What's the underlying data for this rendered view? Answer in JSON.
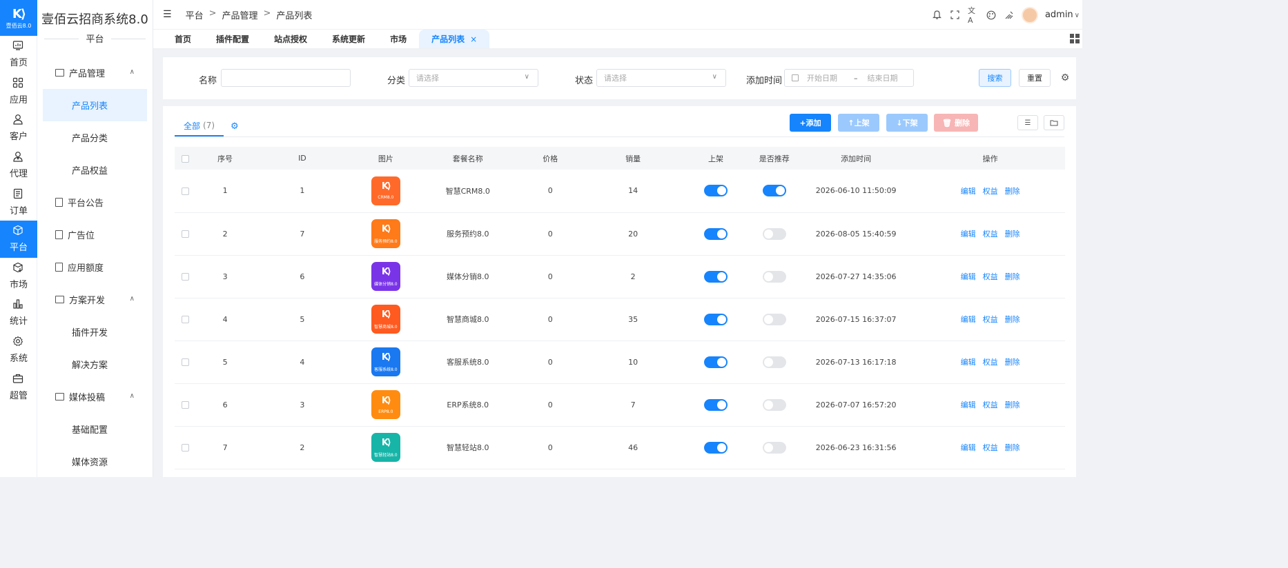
{
  "rail": {
    "logo_text": "壹佰云8.0",
    "items": [
      {
        "label": "首页",
        "icon": "chart-icon"
      },
      {
        "label": "应用",
        "icon": "grid-icon"
      },
      {
        "label": "客户",
        "icon": "user-icon"
      },
      {
        "label": "代理",
        "icon": "agent-icon"
      },
      {
        "label": "订单",
        "icon": "order-icon"
      },
      {
        "label": "平台",
        "icon": "cube-icon",
        "active": true
      },
      {
        "label": "市场",
        "icon": "market-icon"
      },
      {
        "label": "统计",
        "icon": "stats-icon"
      },
      {
        "label": "系统",
        "icon": "gear-icon"
      },
      {
        "label": "超管",
        "icon": "briefcase-icon"
      }
    ]
  },
  "sidebar": {
    "title": "壹佰云招商系统8.0",
    "subtitle": "平台",
    "groups": [
      {
        "label": "产品管理",
        "items": [
          "产品列表",
          "产品分类",
          "产品权益"
        ]
      },
      {
        "label": "平台公告"
      },
      {
        "label": "广告位"
      },
      {
        "label": "应用额度"
      },
      {
        "label": "方案开发",
        "items": [
          "插件开发",
          "解决方案"
        ]
      },
      {
        "label": "媒体投稿",
        "items": [
          "基础配置",
          "媒体资源"
        ]
      }
    ]
  },
  "topbar": {
    "breadcrumb": [
      "平台",
      "产品管理",
      "产品列表"
    ],
    "user": "admin"
  },
  "tabs": [
    "首页",
    "插件配置",
    "站点授权",
    "系统更新",
    "市场",
    "产品列表"
  ],
  "filter": {
    "name_label": "名称",
    "category_label": "分类",
    "category_placeholder": "请选择",
    "status_label": "状态",
    "status_placeholder": "请选择",
    "time_label": "添加时间",
    "start_placeholder": "开始日期",
    "end_placeholder": "结束日期",
    "range_sep": "–",
    "search": "搜索",
    "reset": "重置"
  },
  "table_tabs": {
    "all": "全部",
    "count": "(7)"
  },
  "actions": {
    "add": "+添加",
    "up": "↑上架",
    "down": "↓下架",
    "delete": "删除"
  },
  "columns": [
    "序号",
    "ID",
    "图片",
    "套餐名称",
    "价格",
    "销量",
    "上架",
    "是否推荐",
    "添加时间",
    "操作"
  ],
  "row_ops": [
    "编辑",
    "权益",
    "删除"
  ],
  "rows": [
    {
      "no": "1",
      "id": "1",
      "thumb": "CRM8.0",
      "thumb_color": "#ff6a2a",
      "name": "智慧CRM8.0",
      "price": "0",
      "sales": "14",
      "listed": true,
      "recommended": true,
      "time": "2026-06-10 11:50:09"
    },
    {
      "no": "2",
      "id": "7",
      "thumb": "服务预约8.0",
      "thumb_color": "#ff7a18",
      "name": "服务预约8.0",
      "price": "0",
      "sales": "20",
      "listed": true,
      "recommended": false,
      "time": "2026-08-05 15:40:59"
    },
    {
      "no": "3",
      "id": "6",
      "thumb": "媒体分销8.0",
      "thumb_color": "#7a34e8",
      "name": "媒体分销8.0",
      "price": "0",
      "sales": "2",
      "listed": true,
      "recommended": false,
      "time": "2026-07-27 14:35:06"
    },
    {
      "no": "4",
      "id": "5",
      "thumb": "智慧商城8.0",
      "thumb_color": "#ff5a1f",
      "name": "智慧商城8.0",
      "price": "0",
      "sales": "35",
      "listed": true,
      "recommended": false,
      "time": "2026-07-15 16:37:07"
    },
    {
      "no": "5",
      "id": "4",
      "thumb": "客服系统8.0",
      "thumb_color": "#1a78f0",
      "name": "客服系统8.0",
      "price": "0",
      "sales": "10",
      "listed": true,
      "recommended": false,
      "time": "2026-07-13 16:17:18"
    },
    {
      "no": "6",
      "id": "3",
      "thumb": "ERP8.0",
      "thumb_color": "#ff8c10",
      "name": "ERP系统8.0",
      "price": "0",
      "sales": "7",
      "listed": true,
      "recommended": false,
      "time": "2026-07-07 16:57:20"
    },
    {
      "no": "7",
      "id": "2",
      "thumb": "智慧轻站8.0",
      "thumb_color": "#17b5a8",
      "name": "智慧轻站8.0",
      "price": "0",
      "sales": "46",
      "listed": true,
      "recommended": false,
      "time": "2026-06-23 16:31:56"
    }
  ],
  "colors": {
    "accent": "#1684fc",
    "accent_light": "#e8f3ff",
    "disabled_blue": "#9cc9fd",
    "disabled_red": "#f7b5b5"
  }
}
